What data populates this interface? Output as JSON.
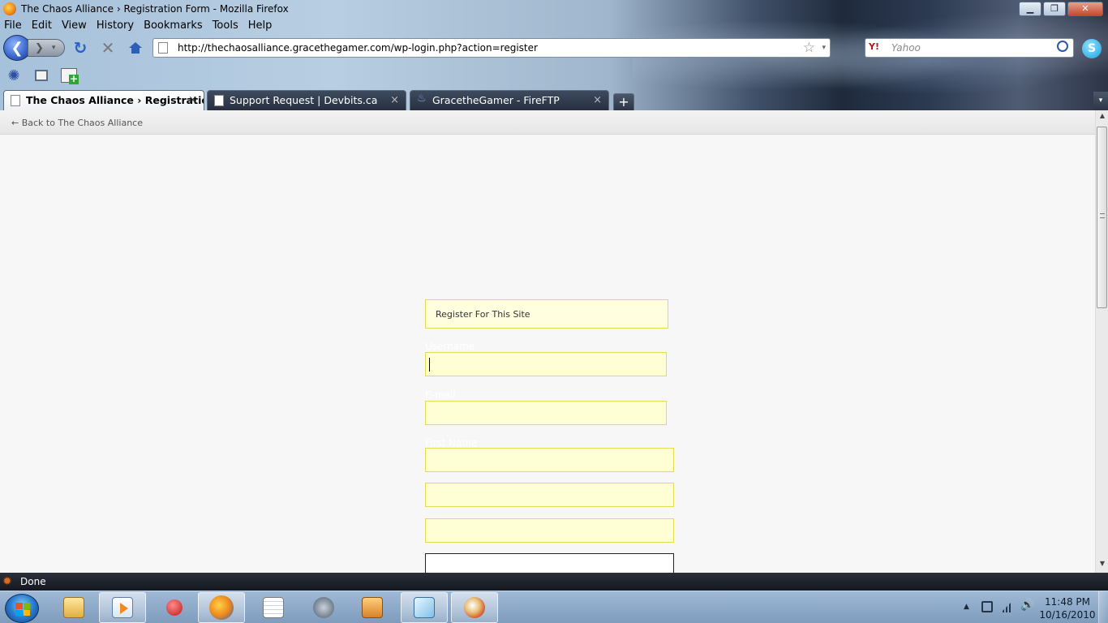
{
  "window": {
    "title": "The Chaos Alliance › Registration Form - Mozilla Firefox",
    "controls": {
      "minimize": "▁",
      "maximize": "❐",
      "close": "✕"
    }
  },
  "menu": [
    "File",
    "Edit",
    "View",
    "History",
    "Bookmarks",
    "Tools",
    "Help"
  ],
  "navigation": {
    "url": "http://thechaosalliance.gracethegamer.com/wp-login.php?action=register",
    "search_engine": "Y!",
    "search_placeholder": "Yahoo",
    "icons": [
      "back-icon",
      "forward-icon",
      "reload-icon",
      "stop-icon",
      "home-icon",
      "bookmark-star-icon",
      "search-icon",
      "skype-icon"
    ]
  },
  "bookmarks_toolbar": {
    "icons": [
      "swirl-icon",
      "window-icon",
      "add-page-icon"
    ]
  },
  "tabs": [
    {
      "label": "The Chaos Alliance › Registration ...",
      "active": true
    },
    {
      "label": "Support Request | Devbits.ca",
      "active": false
    },
    {
      "label": "GracetheGamer - FireFTP",
      "active": false
    }
  ],
  "tab_buttons": {
    "new_tab": "+",
    "list_all": "▾",
    "close": "×"
  },
  "page": {
    "back_link": "← Back to The Chaos Alliance",
    "register_message": "Register For This Site",
    "fields": {
      "username_label": "Username",
      "email_label": "E-mail",
      "first_name_label": "First Name"
    },
    "colors": {
      "message_bg": "#ffffe0",
      "message_border": "#e6db55",
      "field_bg": "#ffffd6"
    }
  },
  "status": {
    "text": "Done"
  },
  "taskbar": {
    "apps": [
      "explorer-icon",
      "media-player-icon",
      "pushpin-icon",
      "firefox-icon",
      "notepad-icon",
      "starcraft-icon",
      "fireftp-icon",
      "paint-net-icon",
      "paint-icon"
    ],
    "clock_time": "11:48 PM",
    "clock_date": "10/16/2010"
  }
}
